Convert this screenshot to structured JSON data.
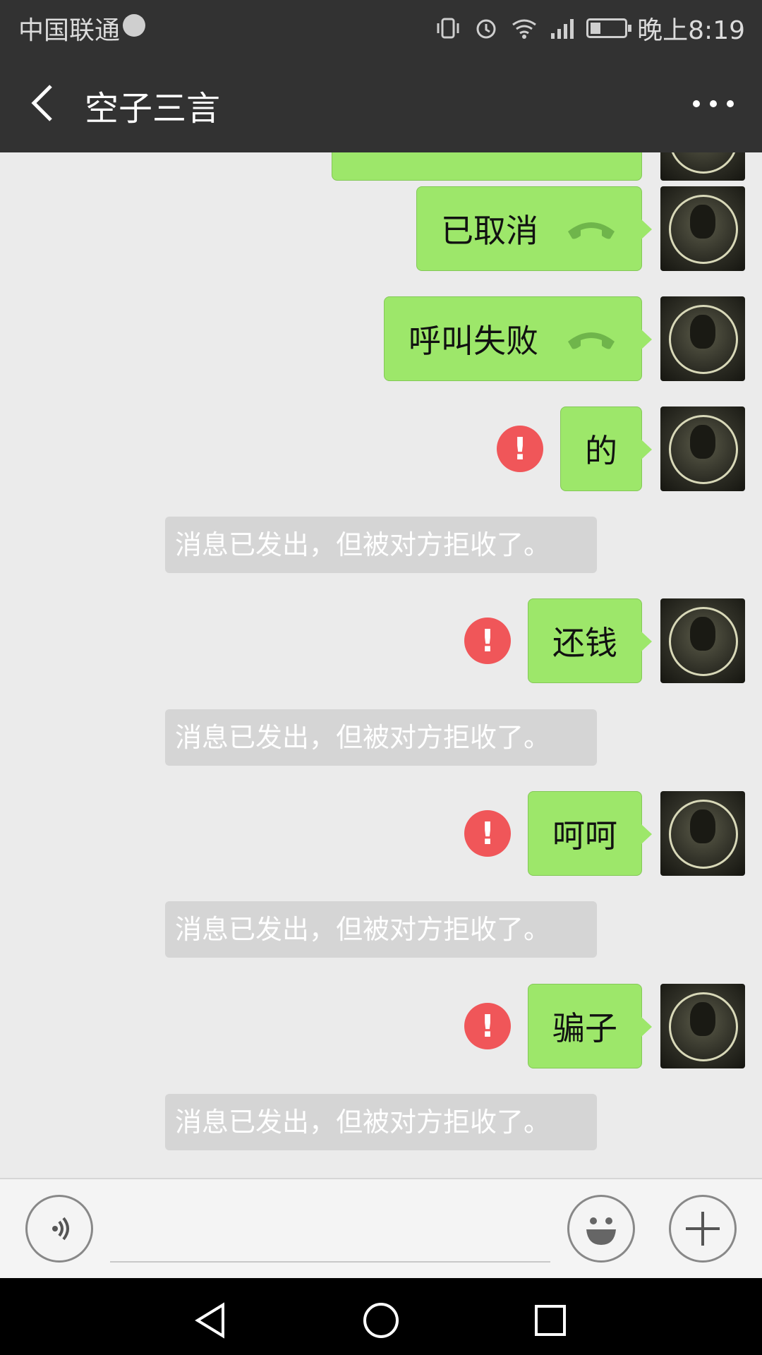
{
  "status_bar": {
    "carrier": "中国联通",
    "time": "晚上8:19"
  },
  "header": {
    "title": "空子三言"
  },
  "messages": [
    {
      "text": "已取消",
      "type": "call"
    },
    {
      "text": "呼叫失败",
      "type": "call"
    },
    {
      "text": "的",
      "type": "text",
      "failed": true
    },
    {
      "text": "还钱",
      "type": "text",
      "failed": true
    },
    {
      "text": "呵呵",
      "type": "text",
      "failed": true
    },
    {
      "text": "骗子",
      "type": "text",
      "failed": true
    }
  ],
  "system_notices": [
    "消息已发出，但被对方拒收了。",
    "消息已发出，但被对方拒收了。",
    "消息已发出，但被对方拒收了。",
    "消息已发出，但被对方拒收了。"
  ],
  "warning_symbol": "!",
  "colors": {
    "bubble": "#9de76a",
    "warning": "#f05659",
    "header": "#323232"
  },
  "icons": {
    "back": "chevron-left-icon",
    "more": "more-dots-icon",
    "call": "phone-hangup-icon",
    "voice": "voice-icon",
    "emoji": "emoji-icon",
    "plus": "plus-icon"
  }
}
